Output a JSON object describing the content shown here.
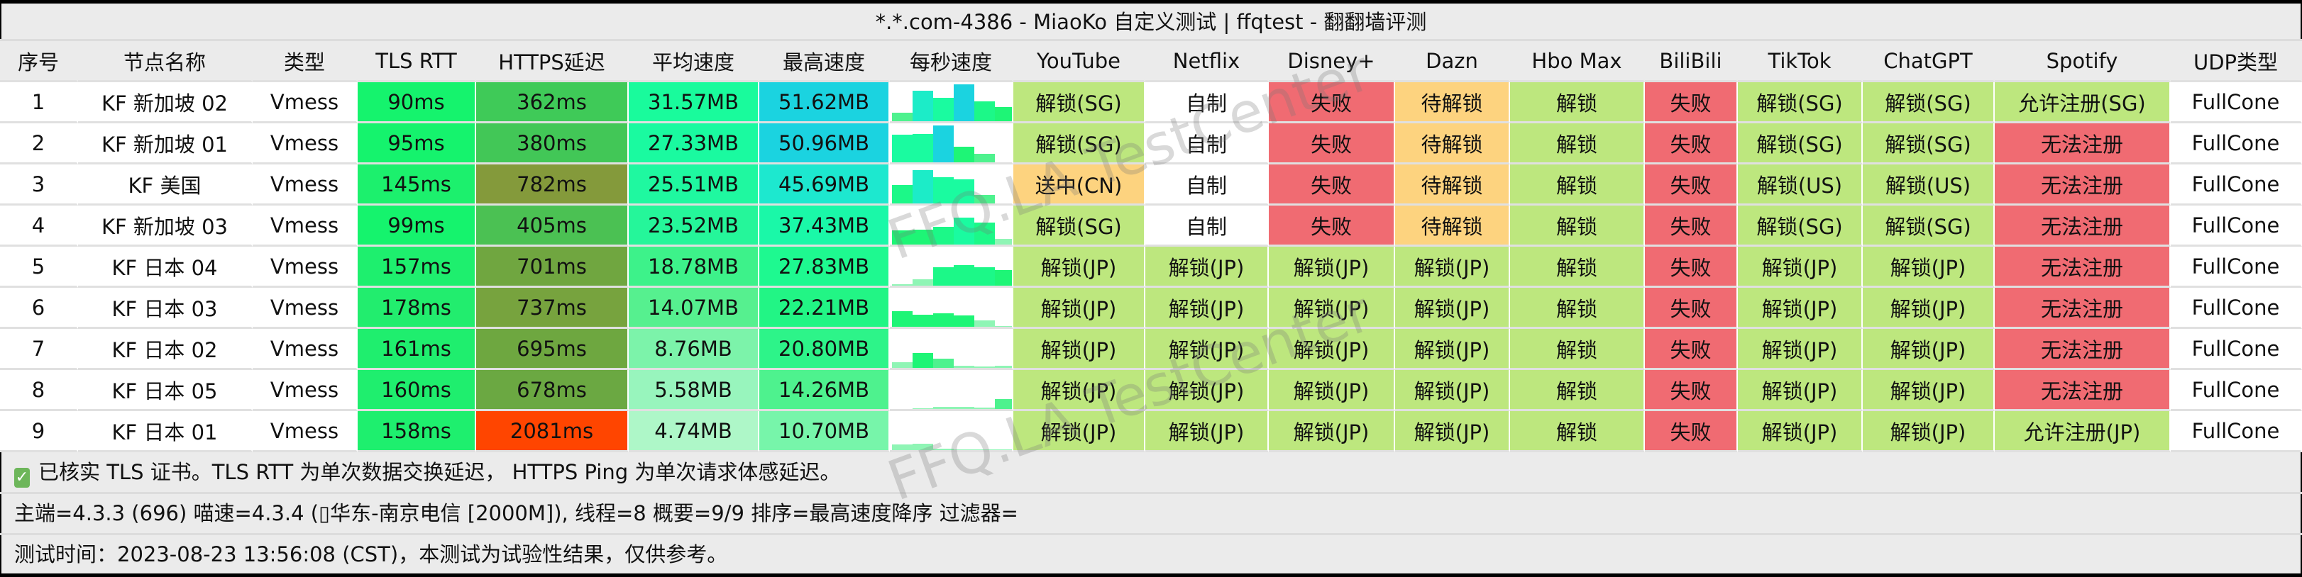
{
  "window": {
    "title": "*.*.com-4386 - MiaoKo 自定义测试 | ffqtest - 翻翻墙评测"
  },
  "table": {
    "headers": [
      "序号",
      "节点名称",
      "类型",
      "TLS RTT",
      "HTTPS延迟",
      "平均速度",
      "最高速度",
      "每秒速度",
      "YouTube",
      "Netflix",
      "Disney+",
      "Dazn",
      "Hbo Max",
      "BiliBili",
      "TikTok",
      "ChatGPT",
      "Spotify",
      "UDP类型"
    ],
    "status_colors": {
      "ok": "#bde77e",
      "fail": "#f06b72",
      "warn": "#fdd37f",
      "none": "#ffffff"
    },
    "rows": [
      {
        "seq": "1",
        "name": "KF 新加坡 02",
        "type": "Vmess",
        "tls": "90ms",
        "tls_color": "#15f36d",
        "https": "362ms",
        "https_color": "#3fca58",
        "avg": "31.57MB",
        "avg_color": "#19fb9c",
        "max": "51.62MB",
        "max_color": "#1bd3e0",
        "per_second": [
          0.24,
          0.82,
          0.64,
          1.0,
          0.53,
          0.39
        ],
        "unlock": [
          [
            "解锁(SG)",
            "ok"
          ],
          [
            "自制",
            "none"
          ],
          [
            "失败",
            "fail"
          ],
          [
            "待解锁",
            "warn"
          ],
          [
            "解锁",
            "ok"
          ],
          [
            "失败",
            "fail"
          ],
          [
            "解锁(SG)",
            "ok"
          ],
          [
            "解锁(SG)",
            "ok"
          ],
          [
            "允许注册(SG)",
            "ok"
          ]
        ],
        "udp": "FullCone"
      },
      {
        "seq": "2",
        "name": "KF 新加坡 01",
        "type": "Vmess",
        "tls": "95ms",
        "tls_color": "#15f36d",
        "https": "380ms",
        "https_color": "#42c757",
        "avg": "27.33MB",
        "avg_color": "#1afaa0",
        "max": "50.96MB",
        "max_color": "#1bd3e0",
        "per_second": [
          0.75,
          0.76,
          1.0,
          0.42,
          0.24,
          0
        ],
        "unlock": [
          [
            "解锁(SG)",
            "ok"
          ],
          [
            "自制",
            "none"
          ],
          [
            "失败",
            "fail"
          ],
          [
            "待解锁",
            "warn"
          ],
          [
            "解锁",
            "ok"
          ],
          [
            "失败",
            "fail"
          ],
          [
            "解锁(SG)",
            "ok"
          ],
          [
            "解锁(SG)",
            "ok"
          ],
          [
            "无法注册",
            "fail"
          ]
        ],
        "udp": "FullCone"
      },
      {
        "seq": "3",
        "name": "KF 美国",
        "type": "Vmess",
        "tls": "145ms",
        "tls_color": "#1cf06d",
        "https": "782ms",
        "https_color": "#849a3b",
        "avg": "25.51MB",
        "avg_color": "#1ff8a0",
        "max": "45.69MB",
        "max_color": "#1de8cf",
        "per_second": [
          0.5,
          0.91,
          0.72,
          0.65,
          0.23,
          0
        ],
        "unlock": [
          [
            "送中(CN)",
            "warn"
          ],
          [
            "自制",
            "none"
          ],
          [
            "失败",
            "fail"
          ],
          [
            "待解锁",
            "warn"
          ],
          [
            "解锁",
            "ok"
          ],
          [
            "失败",
            "fail"
          ],
          [
            "解锁(US)",
            "ok"
          ],
          [
            "解锁(US)",
            "ok"
          ],
          [
            "无法注册",
            "fail"
          ]
        ],
        "udp": "FullCone"
      },
      {
        "seq": "4",
        "name": "KF 新加坡 03",
        "type": "Vmess",
        "tls": "99ms",
        "tls_color": "#15f36d",
        "https": "405ms",
        "https_color": "#4bc153",
        "avg": "23.52MB",
        "avg_color": "#25f69a",
        "max": "37.43MB",
        "max_color": "#1af8a8",
        "per_second": [
          0.39,
          0.41,
          0.48,
          0.73,
          0.59,
          0.16
        ],
        "unlock": [
          [
            "解锁(SG)",
            "ok"
          ],
          [
            "自制",
            "none"
          ],
          [
            "失败",
            "fail"
          ],
          [
            "待解锁",
            "warn"
          ],
          [
            "解锁",
            "ok"
          ],
          [
            "失败",
            "fail"
          ],
          [
            "解锁(SG)",
            "ok"
          ],
          [
            "解锁(SG)",
            "ok"
          ],
          [
            "无法注册",
            "fail"
          ]
        ],
        "udp": "FullCone"
      },
      {
        "seq": "5",
        "name": "KF 日本 04",
        "type": "Vmess",
        "tls": "157ms",
        "tls_color": "#1eef6e",
        "https": "701ms",
        "https_color": "#70a640",
        "avg": "18.78MB",
        "avg_color": "#3df28a",
        "max": "27.83MB",
        "max_color": "#1ef990",
        "per_second": [
          0.03,
          0.18,
          0.5,
          0.55,
          0.5,
          0.42
        ],
        "unlock": [
          [
            "解锁(JP)",
            "ok"
          ],
          [
            "解锁(JP)",
            "ok"
          ],
          [
            "解锁(JP)",
            "ok"
          ],
          [
            "解锁(JP)",
            "ok"
          ],
          [
            "解锁",
            "ok"
          ],
          [
            "失败",
            "fail"
          ],
          [
            "解锁(JP)",
            "ok"
          ],
          [
            "解锁(JP)",
            "ok"
          ],
          [
            "无法注册",
            "fail"
          ]
        ],
        "udp": "FullCone"
      },
      {
        "seq": "6",
        "name": "KF 日本 03",
        "type": "Vmess",
        "tls": "178ms",
        "tls_color": "#22ed6e",
        "https": "737ms",
        "https_color": "#77a33e",
        "avg": "14.07MB",
        "avg_color": "#56f08f",
        "max": "22.21MB",
        "max_color": "#22f585",
        "per_second": [
          0.42,
          0.33,
          0.37,
          0.3,
          0.17,
          0.02
        ],
        "unlock": [
          [
            "解锁(JP)",
            "ok"
          ],
          [
            "解锁(JP)",
            "ok"
          ],
          [
            "解锁(JP)",
            "ok"
          ],
          [
            "解锁(JP)",
            "ok"
          ],
          [
            "解锁",
            "ok"
          ],
          [
            "失败",
            "fail"
          ],
          [
            "解锁(JP)",
            "ok"
          ],
          [
            "解锁(JP)",
            "ok"
          ],
          [
            "无法注册",
            "fail"
          ]
        ],
        "udp": "FullCone"
      },
      {
        "seq": "7",
        "name": "KF 日本 02",
        "type": "Vmess",
        "tls": "161ms",
        "tls_color": "#1fee6e",
        "https": "695ms",
        "https_color": "#6ea740",
        "avg": "8.76MB",
        "avg_color": "#7cf3aa",
        "max": "20.80MB",
        "max_color": "#2df489",
        "per_second": [
          0.16,
          0.41,
          0.25,
          0.05,
          0.03,
          0.06
        ],
        "unlock": [
          [
            "解锁(JP)",
            "ok"
          ],
          [
            "解锁(JP)",
            "ok"
          ],
          [
            "解锁(JP)",
            "ok"
          ],
          [
            "解锁(JP)",
            "ok"
          ],
          [
            "解锁",
            "ok"
          ],
          [
            "失败",
            "fail"
          ],
          [
            "解锁(JP)",
            "ok"
          ],
          [
            "解锁(JP)",
            "ok"
          ],
          [
            "无法注册",
            "fail"
          ]
        ],
        "udp": "FullCone"
      },
      {
        "seq": "8",
        "name": "KF 日本 05",
        "type": "Vmess",
        "tls": "160ms",
        "tls_color": "#1fee6e",
        "https": "678ms",
        "https_color": "#6ba842",
        "avg": "5.58MB",
        "avg_color": "#98f5bd",
        "max": "14.26MB",
        "max_color": "#4ef28e",
        "per_second": [
          0,
          0.02,
          0.06,
          0.06,
          0.04,
          0.26
        ],
        "unlock": [
          [
            "解锁(JP)",
            "ok"
          ],
          [
            "解锁(JP)",
            "ok"
          ],
          [
            "解锁(JP)",
            "ok"
          ],
          [
            "解锁(JP)",
            "ok"
          ],
          [
            "解锁",
            "ok"
          ],
          [
            "失败",
            "fail"
          ],
          [
            "解锁(JP)",
            "ok"
          ],
          [
            "解锁(JP)",
            "ok"
          ],
          [
            "无法注册",
            "fail"
          ]
        ],
        "udp": "FullCone"
      },
      {
        "seq": "9",
        "name": "KF 日本 01",
        "type": "Vmess",
        "tls": "158ms",
        "tls_color": "#1eef6e",
        "https": "2081ms",
        "https_color": "#ff4500",
        "avg": "4.74MB",
        "avg_color": "#aef7c8",
        "max": "10.70MB",
        "max_color": "#77f5aa",
        "per_second": [
          0.15,
          0.18,
          0.03,
          0.01,
          0.01,
          0.01
        ],
        "unlock": [
          [
            "解锁(JP)",
            "ok"
          ],
          [
            "解锁(JP)",
            "ok"
          ],
          [
            "解锁(JP)",
            "ok"
          ],
          [
            "解锁(JP)",
            "ok"
          ],
          [
            "解锁",
            "ok"
          ],
          [
            "失败",
            "fail"
          ],
          [
            "解锁(JP)",
            "ok"
          ],
          [
            "解锁(JP)",
            "ok"
          ],
          [
            "允许注册(JP)",
            "ok"
          ]
        ],
        "udp": "FullCone"
      }
    ]
  },
  "footer": {
    "note_icon": "checkbox-checked-icon",
    "note": "已核实 TLS 证书。TLS RTT 为单次数据交换延迟， HTTPS Ping 为单次请求体感延迟。",
    "info": "主端=4.3.3 (696) 喵速=4.3.4 (▯华东-南京电信 [2000M]), 线程=8 概要=9/9 排序=最高速度降序 过滤器=",
    "time": "测试时间：2023-08-23 13:56:08 (CST)，本测试为试验性结果，仅供参考。"
  },
  "watermark": "FFQ.LA TestCenter"
}
